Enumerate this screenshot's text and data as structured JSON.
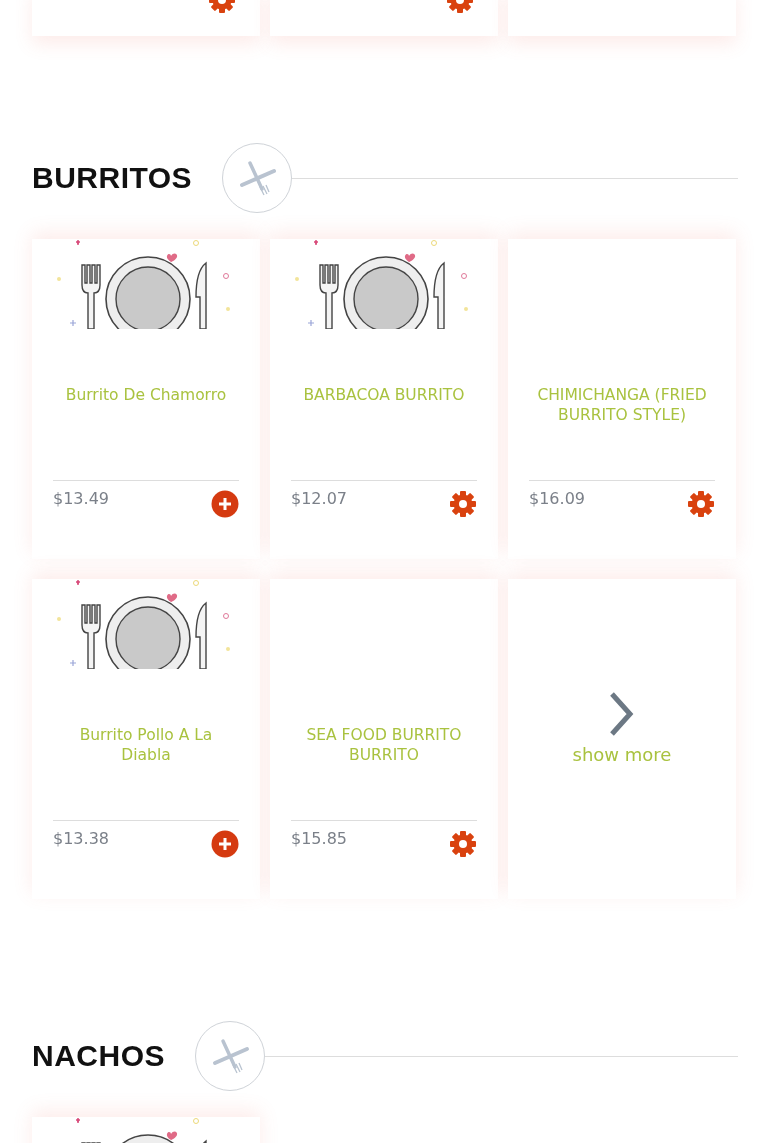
{
  "top_row": [
    {
      "kind": "options"
    },
    {
      "kind": "options"
    },
    {
      "kind": "plain"
    }
  ],
  "sections": [
    {
      "title": "BURRITOS",
      "items": [
        {
          "kind": "add",
          "name": "Burrito De Chamorro",
          "price": "$13.49",
          "has_image": true
        },
        {
          "kind": "options",
          "name": "BARBACOA BURRITO",
          "price": "$12.07",
          "has_image": true
        },
        {
          "kind": "options",
          "name": "CHIMICHANGA (FRIED BURRITO STYLE)",
          "price": "$16.09",
          "has_image": false
        },
        {
          "kind": "add",
          "name": "Burrito Pollo A La Diabla",
          "price": "$13.38",
          "has_image": true
        },
        {
          "kind": "options",
          "name": "SEA FOOD BURRITO BURRITO",
          "price": "$15.85",
          "has_image": false
        },
        {
          "kind": "more",
          "label": "show more"
        }
      ]
    },
    {
      "title": "NACHOS",
      "items": [
        {
          "kind": "plain",
          "has_image": true
        }
      ]
    }
  ]
}
